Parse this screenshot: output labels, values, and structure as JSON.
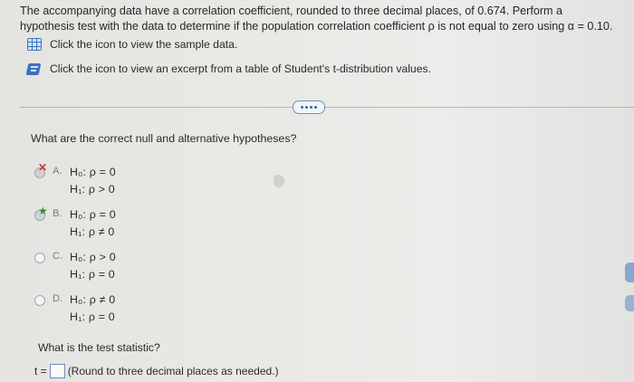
{
  "intro": {
    "line1": "The accompanying data have a correlation coefficient, rounded to three decimal places, of 0.674. Perform a",
    "line2": "hypothesis test with the data to determine if the population correlation coefficient ρ is not equal to zero using",
    "alpha": "α = 0.10."
  },
  "tools": {
    "data_label": "Click the icon to view the sample data.",
    "data_icon": "data-table-icon",
    "table_label": "Click the icon to view an excerpt from a table of Student's t-distribution values.",
    "table_icon": "book-icon"
  },
  "question": "What are the correct null and alternative hypotheses?",
  "options": [
    {
      "letter": "A.",
      "h0": "H₀: ρ = 0",
      "h1": "H₁: ρ > 0",
      "state": "incorrect"
    },
    {
      "letter": "B.",
      "h0": "H₀: ρ = 0",
      "h1": "H₁: ρ ≠ 0",
      "state": "correct"
    },
    {
      "letter": "C.",
      "h0": "H₀: ρ > 0",
      "h1": "H₁: ρ = 0",
      "state": "unselected"
    },
    {
      "letter": "D.",
      "h0": "H₀: ρ ≠ 0",
      "h1": "H₁: ρ = 0",
      "state": "unselected"
    }
  ],
  "marks": {
    "incorrect": "✕",
    "correct": "★"
  },
  "test_statistic": {
    "question": "What is the test statistic?",
    "prefix": "t =",
    "value": "",
    "hint": "(Round to three decimal places as needed.)"
  },
  "colors": {
    "accent": "#3f74c0",
    "incorrect": "#c53a3a",
    "correct": "#3d8a3a"
  }
}
